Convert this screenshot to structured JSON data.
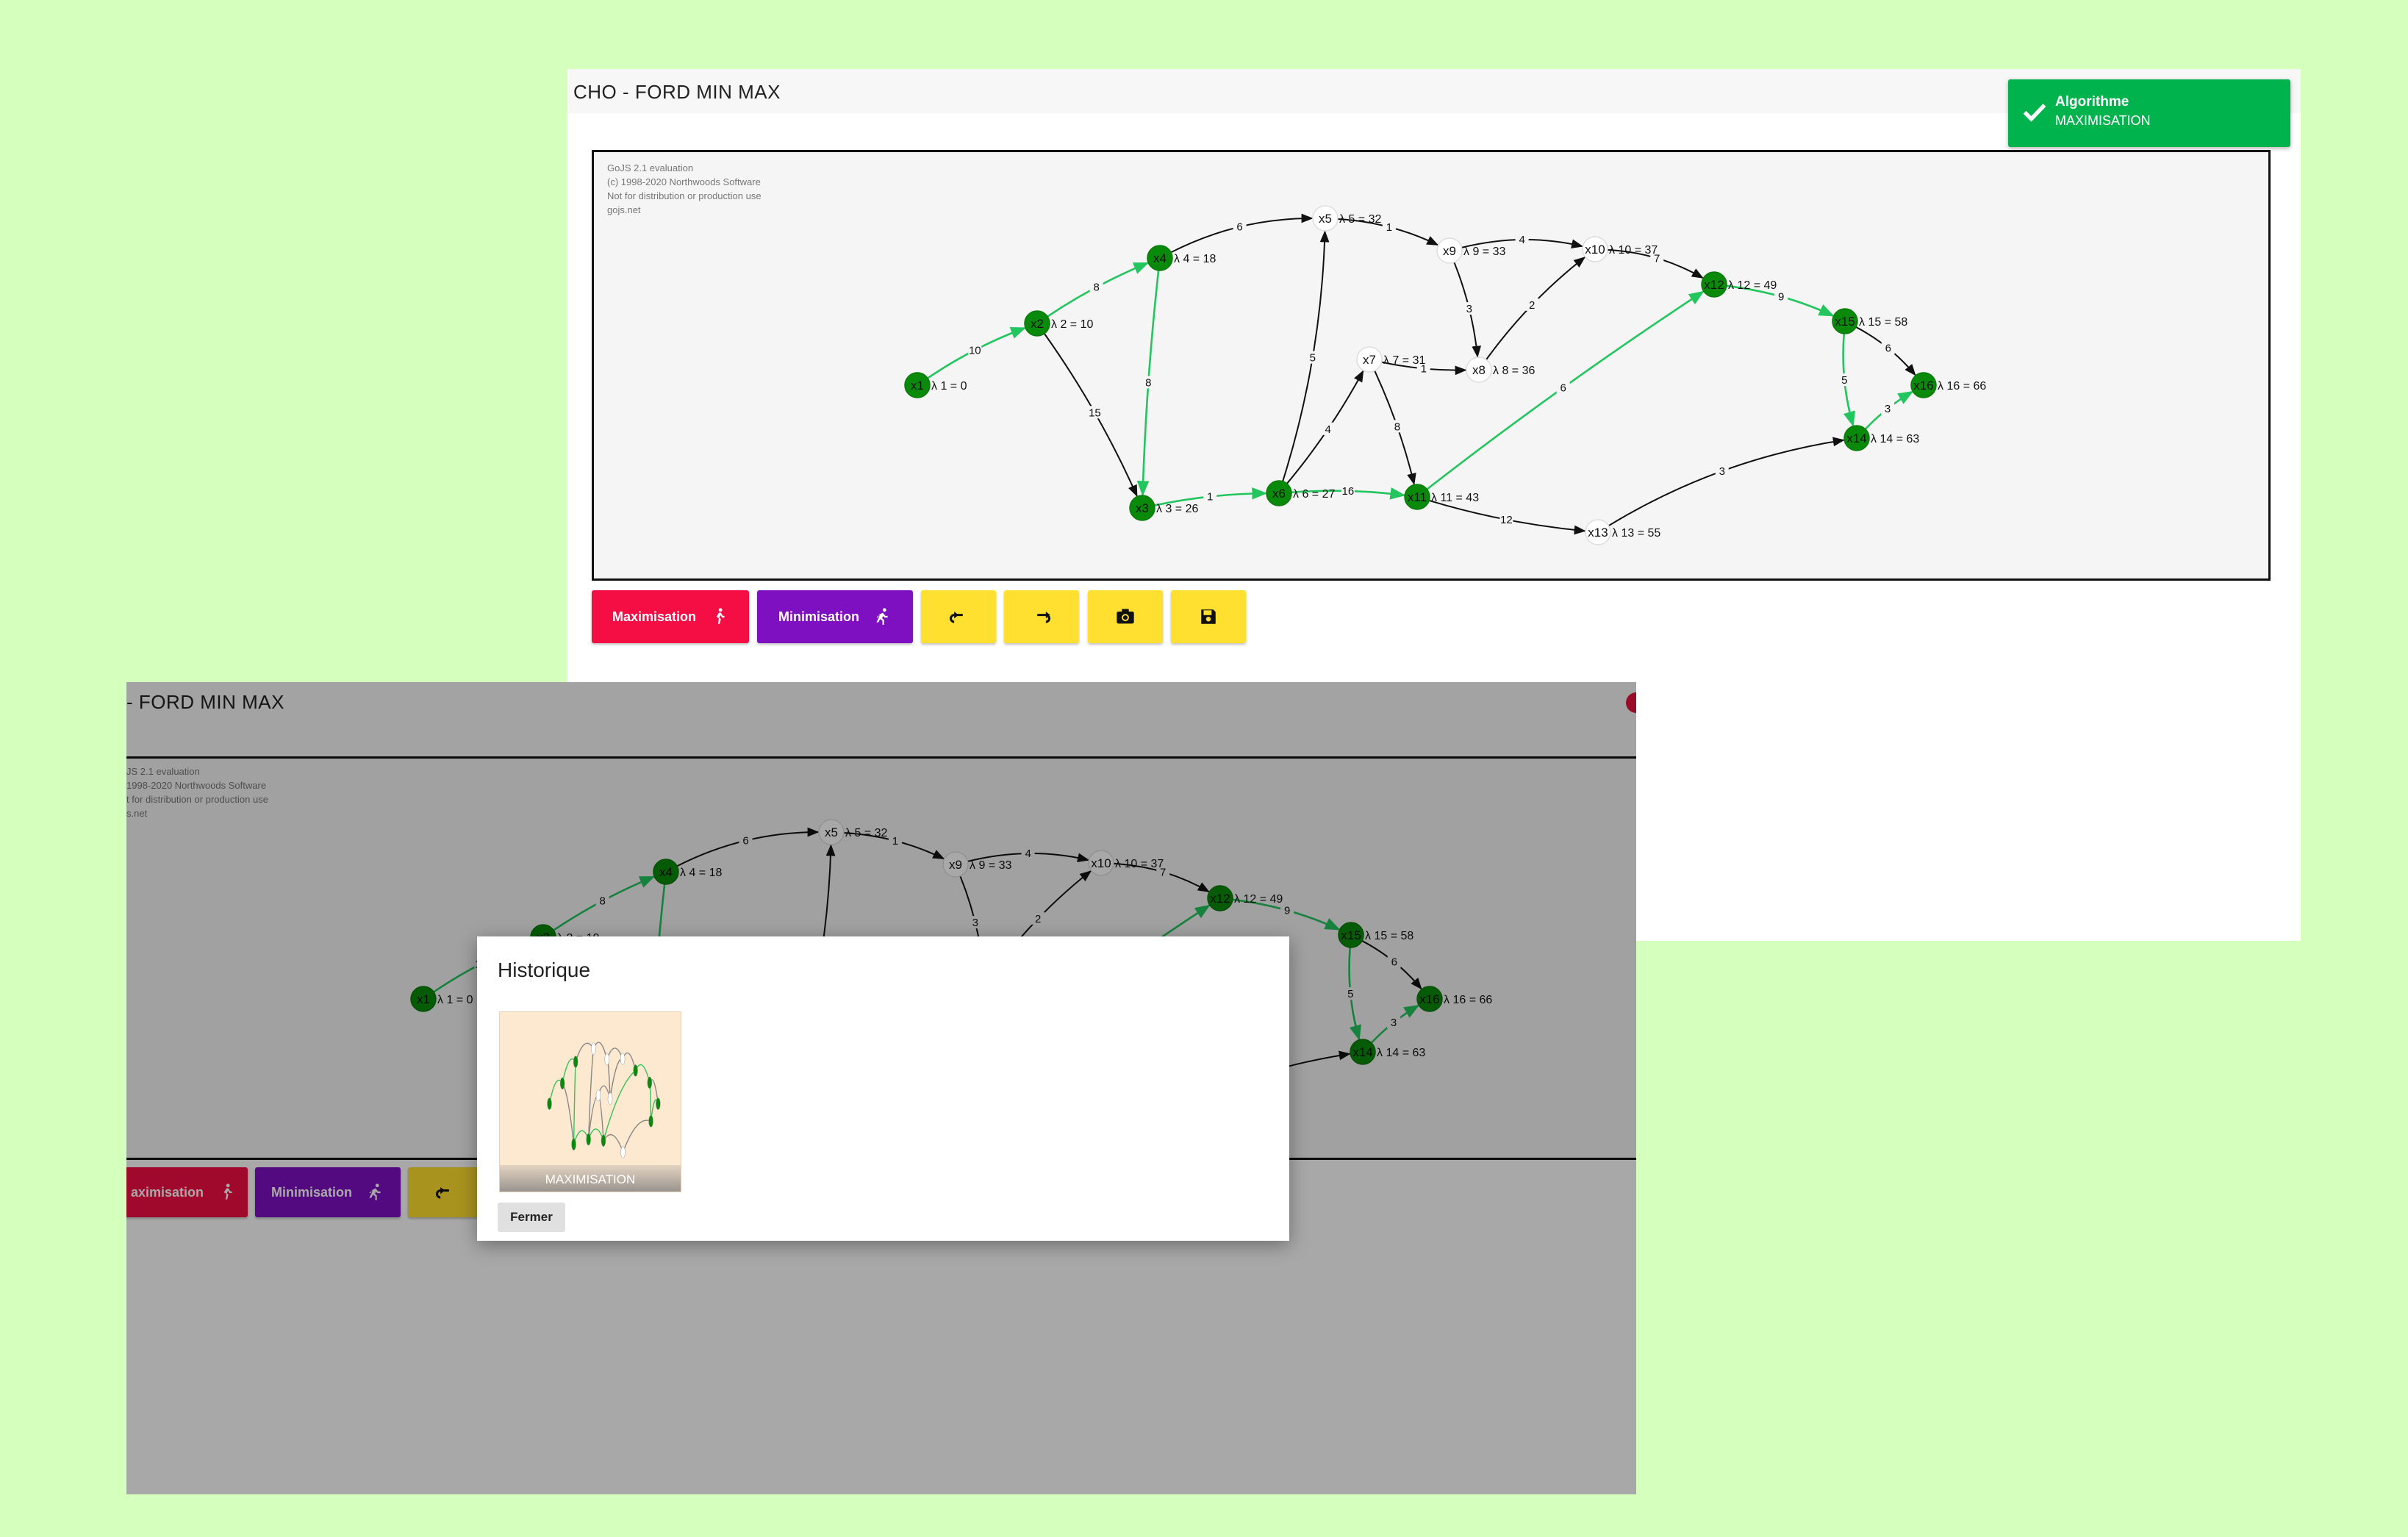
{
  "app": {
    "title": "CHO - FORD MIN MAX",
    "title_partial": "- FORD MIN MAX"
  },
  "watermark": [
    "GoJS 2.1 evaluation",
    "(c) 1998-2020 Northwoods Software",
    "Not for distribution or production use",
    "gojs.net"
  ],
  "watermark_partial": [
    "JS 2.1 evaluation",
    "1998-2020 Northwoods Software",
    "t for distribution or production use",
    "s.net"
  ],
  "toolbar": {
    "maximize_label": "Maximisation",
    "maximize_label_partial": "aximisation",
    "minimize_label": "Minimisation",
    "undo_icon": "undo-icon",
    "redo_icon": "redo-icon",
    "camera_icon": "camera-icon",
    "save_icon": "save-icon"
  },
  "toast": {
    "title": "Algorithme",
    "message": "MAXIMISATION",
    "icon": "check-icon"
  },
  "modal": {
    "title": "Historique",
    "thumbnail_caption": "MAXIMISATION",
    "close_label": "Fermer"
  },
  "graph": {
    "nodes": [
      {
        "id": "x1",
        "label": "λ 1 = 0",
        "active": true
      },
      {
        "id": "x2",
        "label": "λ 2 = 10",
        "active": true
      },
      {
        "id": "x3",
        "label": "λ 3 = 26",
        "active": true
      },
      {
        "id": "x4",
        "label": "λ 4 = 18",
        "active": true
      },
      {
        "id": "x5",
        "label": "λ 5 = 32",
        "active": false
      },
      {
        "id": "x6",
        "label": "λ 6 = 27",
        "active": true
      },
      {
        "id": "x7",
        "label": "λ 7 = 31",
        "active": false
      },
      {
        "id": "x8",
        "label": "λ 8 = 36",
        "active": false
      },
      {
        "id": "x9",
        "label": "λ 9 = 33",
        "active": false
      },
      {
        "id": "x10",
        "label": "λ 10 = 37",
        "active": false
      },
      {
        "id": "x11",
        "label": "λ 11 = 43",
        "active": true
      },
      {
        "id": "x12",
        "label": "λ 12 = 49",
        "active": true
      },
      {
        "id": "x13",
        "label": "λ 13 = 55",
        "active": false
      },
      {
        "id": "x14",
        "label": "λ 14 = 63",
        "active": true
      },
      {
        "id": "x15",
        "label": "λ 15 = 58",
        "active": true
      },
      {
        "id": "x16",
        "label": "λ 16 = 66",
        "active": true
      }
    ],
    "edges": [
      {
        "from": "x1",
        "to": "x2",
        "weight": "10",
        "critical": true
      },
      {
        "from": "x2",
        "to": "x4",
        "weight": "8",
        "critical": true
      },
      {
        "from": "x2",
        "to": "x3",
        "weight": "15",
        "critical": false
      },
      {
        "from": "x4",
        "to": "x3",
        "weight": "8",
        "critical": true
      },
      {
        "from": "x4",
        "to": "x5",
        "weight": "6",
        "critical": false
      },
      {
        "from": "x3",
        "to": "x6",
        "weight": "1",
        "critical": true
      },
      {
        "from": "x6",
        "to": "x5",
        "weight": "5",
        "critical": false
      },
      {
        "from": "x6",
        "to": "x7",
        "weight": "4",
        "critical": false
      },
      {
        "from": "x6",
        "to": "x11",
        "weight": "16",
        "critical": true
      },
      {
        "from": "x5",
        "to": "x9",
        "weight": "1",
        "critical": false
      },
      {
        "from": "x7",
        "to": "x8",
        "weight": "1",
        "critical": false
      },
      {
        "from": "x7",
        "to": "x11",
        "weight": "8",
        "critical": false
      },
      {
        "from": "x9",
        "to": "x10",
        "weight": "4",
        "critical": false
      },
      {
        "from": "x9",
        "to": "x8",
        "weight": "3",
        "critical": false
      },
      {
        "from": "x8",
        "to": "x10",
        "weight": "2",
        "critical": false
      },
      {
        "from": "x10",
        "to": "x12",
        "weight": "7",
        "critical": false
      },
      {
        "from": "x11",
        "to": "x12",
        "weight": "6",
        "critical": true
      },
      {
        "from": "x11",
        "to": "x13",
        "weight": "12",
        "critical": false
      },
      {
        "from": "x12",
        "to": "x15",
        "weight": "9",
        "critical": true
      },
      {
        "from": "x13",
        "to": "x14",
        "weight": "3",
        "critical": false
      },
      {
        "from": "x15",
        "to": "x16",
        "weight": "6",
        "critical": false
      },
      {
        "from": "x15",
        "to": "x14",
        "weight": "5",
        "critical": true
      },
      {
        "from": "x14",
        "to": "x16",
        "weight": "3",
        "critical": true
      }
    ]
  },
  "colors": {
    "critical_edge": "#22c55e",
    "node_active": "#0a8a0a",
    "node_inactive": "#ffffff",
    "maximize": "#f50e43",
    "minimize": "#7f10c2",
    "tool": "#ffe030",
    "toast": "#00b34c",
    "background": "#d5ffbd"
  }
}
